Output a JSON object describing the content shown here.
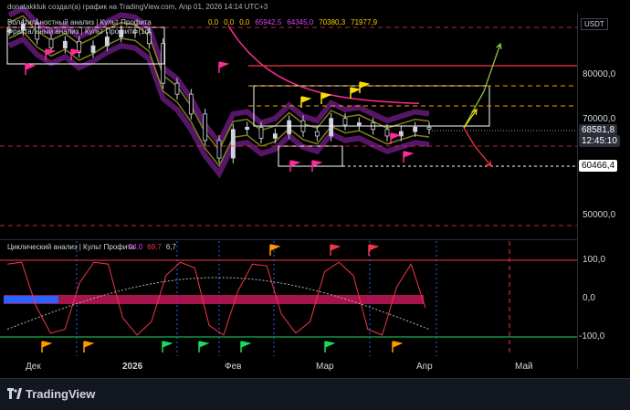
{
  "header": {
    "headline": "donatakkluk создал(а) график на TradingView.com, Апр 01, 2026 14:14 UTC+3",
    "indicator1_prefix": "Волатильностный анализ | Культ Профита",
    "values": [
      {
        "text": "0,0",
        "color": "#f7d000"
      },
      {
        "text": "0,0",
        "color": "#f7d000"
      },
      {
        "text": "0,0",
        "color": "#f7d000"
      },
      {
        "text": "65942,5",
        "color": "#e040fb"
      },
      {
        "text": "64345,0",
        "color": "#e040fb"
      },
      {
        "text": "70380,3",
        "color": "#f7d000"
      },
      {
        "text": "71977,9",
        "color": "#f7d000"
      }
    ],
    "indicator2_label": "Фрактальный анализ | Культ Профита   (1d)",
    "indicator3_label": "Циклический анализ | Культ Профита",
    "indicator3_values": [
      {
        "text": "-24,0",
        "color": "#e040fb"
      },
      {
        "text": "69,7",
        "color": "#f23645"
      },
      {
        "text": "6,7",
        "color": "#d1d4dc"
      }
    ]
  },
  "scale": {
    "currency": "USDT",
    "price_labels": [
      "80000,0",
      "70000,0",
      "50000,0"
    ],
    "current_price": "68581,8",
    "countdown": "12:45:10",
    "support_price": "60466,4",
    "osc_labels": [
      "100,0",
      "0,0",
      "-100,0"
    ]
  },
  "footer": {
    "brand": "TradingView",
    "x_labels": [
      "Дек",
      "2026",
      "Фев",
      "Мар",
      "Апр",
      "Май"
    ]
  },
  "colors": {
    "magenta": "#e040fb",
    "pink": "#ff2a9a",
    "yellow": "#f7e000",
    "red": "#f23645",
    "green": "#1ed760",
    "orange": "#ff9800",
    "blue": "#2962ff"
  },
  "chart_data": [
    {
      "type": "line",
      "series": [
        {
          "values": [
            91000,
            92500,
            89000,
            87000,
            88500,
            86000,
            87500,
            89500,
            91000,
            90500,
            88000,
            79000,
            76500,
            72000,
            66000,
            62000,
            68500,
            69000,
            66500,
            67500,
            70500,
            68000,
            67000,
            71000,
            69500,
            70000,
            68500,
            67000,
            68000,
            69000,
            68581.8
          ]
        }
      ],
      "ylim": [
        45000,
        95000
      ],
      "price_labels": [
        "80000,0",
        "70000,0",
        "50000,0"
      ]
    },
    {
      "type": "line",
      "series": [
        {
          "values": [
            90,
            95,
            -20,
            -90,
            -80,
            40,
            95,
            90,
            -50,
            -95,
            -60,
            60,
            95,
            80,
            -70,
            -95,
            20,
            90,
            85,
            -40,
            -90,
            -60,
            70,
            95,
            60,
            -80,
            -95,
            30,
            90,
            -24
          ]
        }
      ],
      "ylim": [
        -100,
        100
      ],
      "osc_labels": [
        "100,0",
        "0,0",
        "-100,0"
      ]
    }
  ]
}
